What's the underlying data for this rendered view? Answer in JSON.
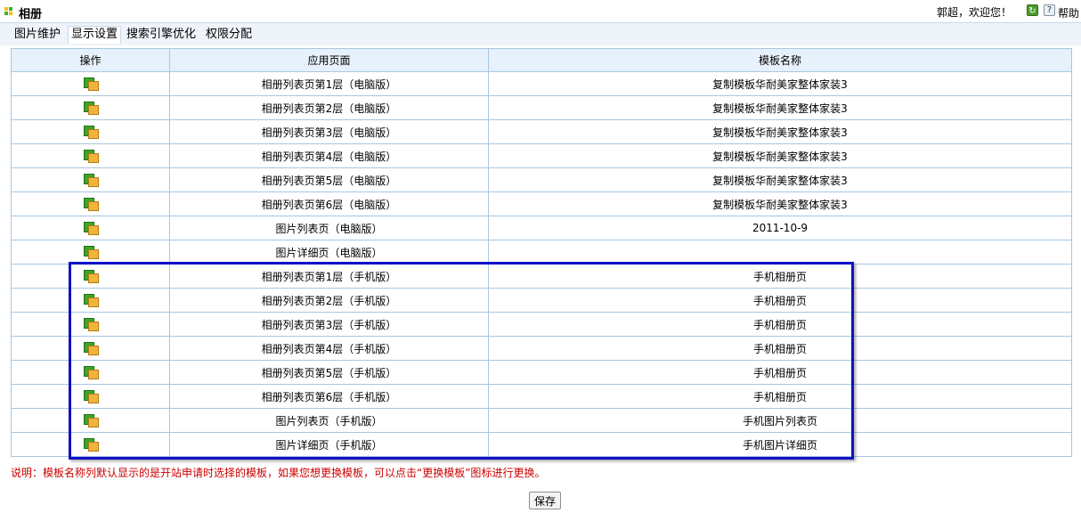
{
  "header": {
    "title": "相册",
    "welcome": "郭超，欢迎您！",
    "help_label": "帮助"
  },
  "tabs": [
    {
      "label": "图片维护"
    },
    {
      "label": "显示设置",
      "active": true
    },
    {
      "label": "搜索引擎优化"
    },
    {
      "label": "权限分配"
    }
  ],
  "table": {
    "columns": [
      "操作",
      "应用页面",
      "模板名称"
    ],
    "rows": [
      {
        "page": "相册列表页第1层（电脑版）",
        "template": "复制模板华耐美家整体家装3"
      },
      {
        "page": "相册列表页第2层（电脑版）",
        "template": "复制模板华耐美家整体家装3"
      },
      {
        "page": "相册列表页第3层（电脑版）",
        "template": "复制模板华耐美家整体家装3"
      },
      {
        "page": "相册列表页第4层（电脑版）",
        "template": "复制模板华耐美家整体家装3"
      },
      {
        "page": "相册列表页第5层（电脑版）",
        "template": "复制模板华耐美家整体家装3"
      },
      {
        "page": "相册列表页第6层（电脑版）",
        "template": "复制模板华耐美家整体家装3"
      },
      {
        "page": "图片列表页（电脑版）",
        "template": "2011-10-9"
      },
      {
        "page": "图片详细页（电脑版）",
        "template": ""
      },
      {
        "page": "相册列表页第1层（手机版）",
        "template": "手机相册页"
      },
      {
        "page": "相册列表页第2层（手机版）",
        "template": "手机相册页"
      },
      {
        "page": "相册列表页第3层（手机版）",
        "template": "手机相册页"
      },
      {
        "page": "相册列表页第4层（手机版）",
        "template": "手机相册页"
      },
      {
        "page": "相册列表页第5层（手机版）",
        "template": "手机相册页"
      },
      {
        "page": "相册列表页第6层（手机版）",
        "template": "手机相册页"
      },
      {
        "page": "图片列表页（手机版）",
        "template": "手机图片列表页"
      },
      {
        "page": "图片详细页（手机版）",
        "template": "手机图片详细页"
      }
    ]
  },
  "note": "说明：模板名称列默认显示的是开站申请时选择的模板，如果您想更换模板，可以点击“更换模板”图标进行更换。",
  "save_label": "保存",
  "colors": {
    "highlight": "#1010c8",
    "note": "#cc0000",
    "header_bg": "#e6f1fb"
  },
  "icons": {
    "row_action": "change-template-icon",
    "refresh": "refresh-icon",
    "help": "help-icon"
  }
}
